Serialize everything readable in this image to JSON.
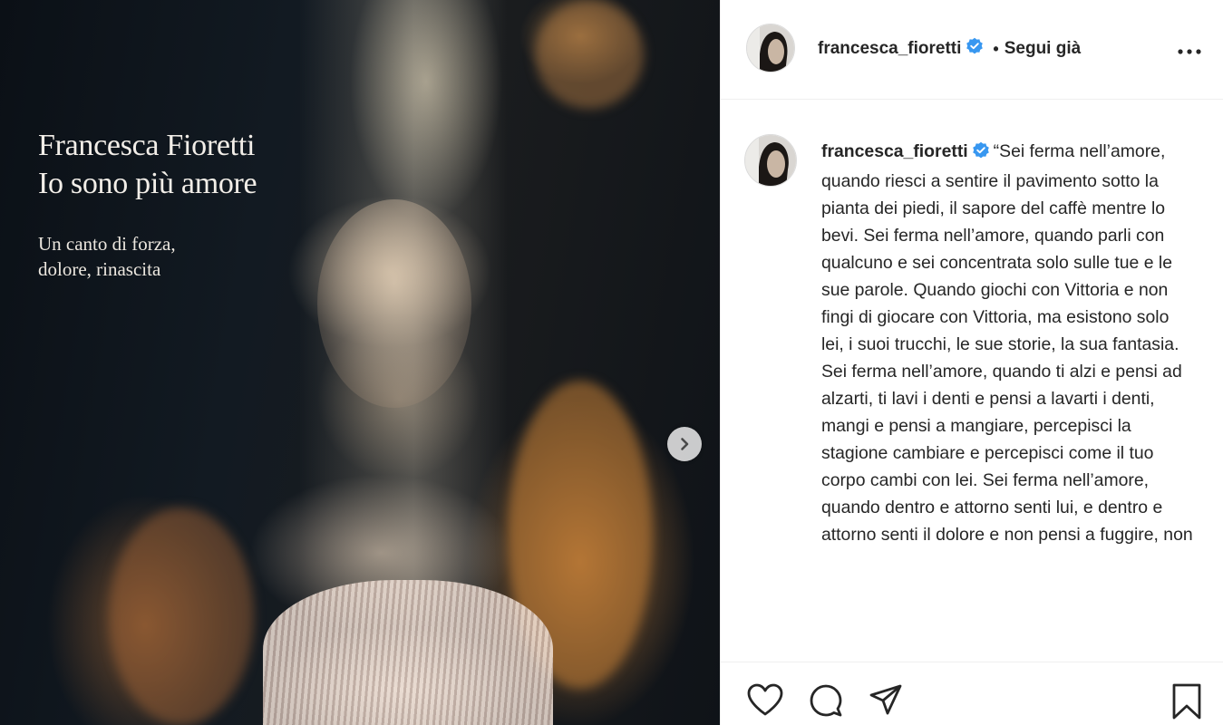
{
  "post": {
    "image": {
      "title_lines": [
        "Francesca Fioretti",
        "Io sono più amore"
      ],
      "subtitle_lines": [
        "Un canto di forza,",
        "dolore, rinascita"
      ],
      "next_icon": "chevron-right-icon"
    },
    "header": {
      "username": "francesca_fioretti",
      "verified_icon": "verified-badge-icon",
      "separator": "•",
      "follow_label": "Segui già",
      "more_icon": "more-horizontal-icon"
    },
    "caption": {
      "username": "francesca_fioretti",
      "text": "“Sei ferma nell’amore, quando riesci a sentire il pavimento sotto la pianta dei piedi, il sapore del caffè mentre lo bevi. Sei ferma nell’amore, quando parli con qualcuno e sei concentrata solo sulle tue e le sue parole. Quando giochi con Vittoria e non fingi di giocare con Vittoria, ma esistono solo lei, i suoi trucchi, le sue storie, la sua fantasia. Sei ferma nell’amore, quando ti alzi e pensi ad alzarti, ti lavi i denti e pensi a lavarti i denti, mangi e pensi a mangiare, percepisci la stagione cambiare e percepisci come il tuo corpo cambi con lei. Sei ferma nell’amore, quando dentro e attorno senti lui, e dentro e attorno senti il dolore e non pensi a fuggire, non"
    },
    "actions": {
      "like_icon": "heart-icon",
      "comment_icon": "comment-icon",
      "share_icon": "paper-plane-icon",
      "save_icon": "bookmark-icon"
    },
    "colors": {
      "text": "#262626",
      "verified": "#3897f0",
      "border": "#efefef"
    }
  }
}
